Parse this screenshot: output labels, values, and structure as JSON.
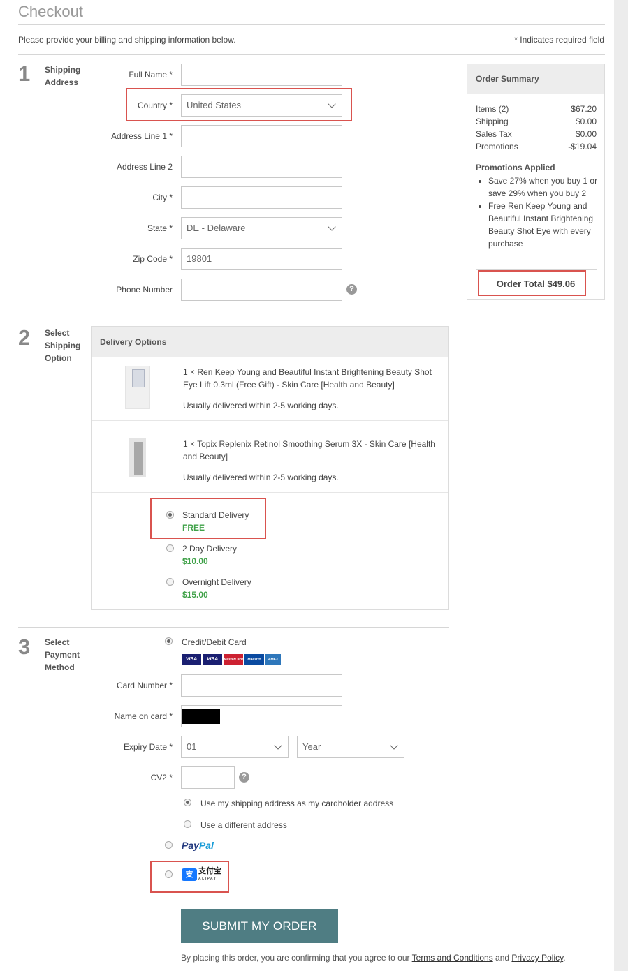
{
  "header": {
    "title": "Checkout",
    "intro": "Please provide your billing and shipping information below.",
    "required_note": "* Indicates required field"
  },
  "step1": {
    "number": "1",
    "label_line1": "Shipping",
    "label_line2": "Address",
    "fields": {
      "full_name_label": "Full Name *",
      "country_label": "Country *",
      "country_value": "United States",
      "address1_label": "Address Line 1 *",
      "address2_label": "Address Line 2",
      "city_label": "City *",
      "state_label": "State *",
      "state_value": "DE - Delaware",
      "zip_label": "Zip Code *",
      "zip_value": "19801",
      "phone_label": "Phone Number",
      "help_glyph": "?"
    }
  },
  "summary": {
    "title": "Order Summary",
    "rows": [
      {
        "label": "Items (2)",
        "value": "$67.20"
      },
      {
        "label": "Shipping",
        "value": "$0.00"
      },
      {
        "label": "Sales Tax",
        "value": "$0.00"
      },
      {
        "label": "Promotions",
        "value": "-$19.04"
      }
    ],
    "promos_title": "Promotions Applied",
    "promos": [
      "Save 27% when you buy 1 or save 29% when you buy 2",
      "Free Ren Keep Young and Beautiful Instant Brightening Beauty Shot Eye with every purchase"
    ],
    "total": "Order Total $49.06"
  },
  "step2": {
    "number": "2",
    "label_line1": "Select",
    "label_line2": "Shipping",
    "label_line3": "Option",
    "panel_title": "Delivery Options",
    "items": [
      {
        "desc": "1 × Ren Keep Young and Beautiful Instant Brightening Beauty Shot Eye Lift 0.3ml (Free Gift) - Skin Care [Health and Beauty]",
        "eta": "Usually delivered within 2-5 working days."
      },
      {
        "desc": "1 × Topix Replenix Retinol Smoothing Serum 3X - Skin Care [Health and Beauty]",
        "eta": "Usually delivered within 2-5 working days."
      }
    ],
    "options": [
      {
        "name": "Standard Delivery",
        "price": "FREE"
      },
      {
        "name": "2 Day Delivery",
        "price": "$10.00"
      },
      {
        "name": "Overnight Delivery",
        "price": "$15.00"
      }
    ]
  },
  "step3": {
    "number": "3",
    "label_line1": "Select",
    "label_line2": "Payment",
    "label_line3": "Method",
    "card_option": "Credit/Debit Card",
    "card_logos": [
      "VISA",
      "VISA",
      "MasterCard",
      "Maestro",
      "AMEX"
    ],
    "card_number_label": "Card Number *",
    "name_on_card_label": "Name on card *",
    "expiry_label": "Expiry Date *",
    "expiry_month": "01",
    "expiry_year": "Year",
    "cv2_label": "CV2 *",
    "address_same": "Use my shipping address as my cardholder address",
    "address_diff": "Use a different address",
    "paypal_a": "Pay",
    "paypal_b": "Pal",
    "alipay_glyph": "支",
    "alipay_text": "支付宝",
    "alipay_sub": "ALIPAY"
  },
  "footer": {
    "submit": "SUBMIT MY ORDER",
    "agree_prefix": "By placing this order, you are confirming that you agree to our",
    "terms": "Terms and Conditions",
    "and": "and",
    "privacy": "Privacy Policy",
    "period": "."
  },
  "colors": {
    "accent_button": "#4f7d83",
    "highlight_box": "#d9534f",
    "price_green": "#3fa148"
  }
}
